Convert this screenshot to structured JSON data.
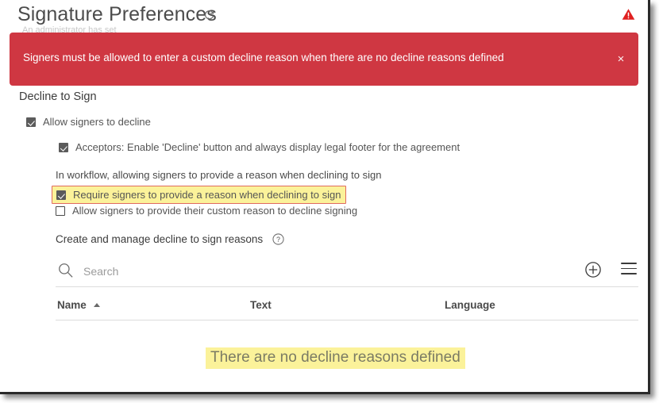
{
  "window": {
    "title": "Signature Preferences",
    "refresh_icon": "refresh-icon",
    "warning_icon": "warning-triangle-icon",
    "obscured_line": "An administrator has set"
  },
  "alert": {
    "message": "Signers must be allowed to enter a custom decline reason when there are no decline reasons defined",
    "close_label": "×",
    "background_color": "#cf3742",
    "text_color": "#ffffff"
  },
  "section": {
    "title": "Decline to Sign"
  },
  "checkboxes": [
    {
      "label": "Allow signers to decline",
      "checked": true,
      "name": "allow-signers-to-decline"
    },
    {
      "label": "Acceptors: Enable 'Decline' button and always display legal footer for the agreement",
      "checked": true,
      "name": "acceptors-enable-decline-button"
    },
    {
      "label": "Require signers to provide a reason when declining to sign",
      "checked": true,
      "name": "require-reason-when-declining",
      "highlighted": true,
      "highlight_color": "#fbf29a",
      "outline_color": "#e06a5e"
    },
    {
      "label": "Allow signers to provide their custom reason to decline signing",
      "checked": false,
      "name": "allow-custom-decline-reason"
    }
  ],
  "workflow_note": "In workflow, allowing signers to provide a reason when declining to sign",
  "manage": {
    "label": "Create and manage decline to sign reasons",
    "help_icon": "help-circle-icon"
  },
  "search": {
    "placeholder": "Search",
    "value": "",
    "search_icon": "search-icon",
    "add_icon": "plus-circle-icon",
    "menu_icon": "hamburger-menu-icon"
  },
  "table": {
    "columns": [
      {
        "label": "Name",
        "sort": "asc"
      },
      {
        "label": "Text",
        "sort": "none"
      },
      {
        "label": "Language",
        "sort": "none"
      }
    ],
    "rows": [],
    "empty_message": "There are no decline reasons defined",
    "empty_highlight_color": "#fbf29a"
  }
}
